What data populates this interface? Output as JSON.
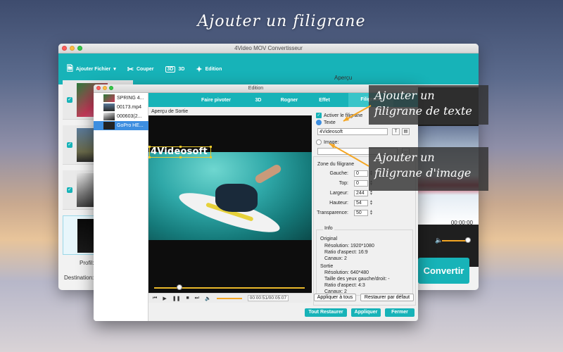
{
  "headline": "Ajouter un filigrane",
  "main_window": {
    "title": "4Video MOV Convertisseur",
    "toolbar": {
      "add_file": "Ajouter Fichier",
      "cut": "Couper",
      "threed": "3D",
      "threed_badge": "3D",
      "edit": "Edition"
    },
    "apercu_label": "Aperçu",
    "preview_time": "00:00:00",
    "profil_label": "Profil:",
    "destination_label": "Destination:",
    "convert_button": "Convertir"
  },
  "edition_window": {
    "title": "Edition",
    "files": [
      {
        "name": "SPRING 4..."
      },
      {
        "name": "00173.mp4"
      },
      {
        "name": "000603(2..."
      },
      {
        "name": "GoPro HE..."
      }
    ],
    "tabs": [
      {
        "label": "Faire pivoter"
      },
      {
        "label": "3D"
      },
      {
        "label": "Rogner"
      },
      {
        "label": "Effet"
      },
      {
        "label": "Filigrane"
      }
    ],
    "output_preview_label": "Aperçu de Sortie",
    "watermark_overlay_text": "4Videosoft",
    "player": {
      "current_time": "00:00:51",
      "total_time": "00:05:07",
      "time_display": "00:00:51/00:05:07"
    },
    "watermark_panel": {
      "enable_label": "Activer le filigrane",
      "text_label": "Texte",
      "text_value": "4Videosoft",
      "image_label": "Image:",
      "zone_label": "Zone du filigrane",
      "fields": {
        "gauche_label": "Gauche:",
        "gauche_value": "0",
        "top_label": "Top:",
        "top_value": "0",
        "largeur_label": "Largeur:",
        "largeur_value": "244",
        "hauteur_label": "Hauteur:",
        "hauteur_value": "54",
        "transparence_label": "Transparence:",
        "transparence_value": "50"
      },
      "info_title": "Info",
      "original_title": "Original",
      "original_resolution": "Résolution: 1920*1080",
      "original_ratio": "Ratio d'aspect: 16:9",
      "original_channels": "Canaux: 2",
      "sortie_title": "Sortie",
      "sortie_resolution": "Résolution: 640*480",
      "sortie_eye": "Taille des yeux gauche/droit: -",
      "sortie_ratio": "Ratio d'aspect: 4:3",
      "sortie_channels": "Canaux: 2",
      "apply_all": "Appliquer à tous",
      "restore_default": "Restaurer par défaut"
    },
    "buttons": {
      "restore_all": "Tout Restaurer",
      "apply": "Appliquer",
      "close": "Fermer"
    }
  },
  "callouts": {
    "text_watermark": "Ajouter un filigrane de texte",
    "image_watermark": "Ajouter un filigrane d'image"
  },
  "colors": {
    "accent": "#17b3b8",
    "selection": "#3d8ee0",
    "watermark_frame": "#e8c72a",
    "volume": "#f4a623"
  }
}
